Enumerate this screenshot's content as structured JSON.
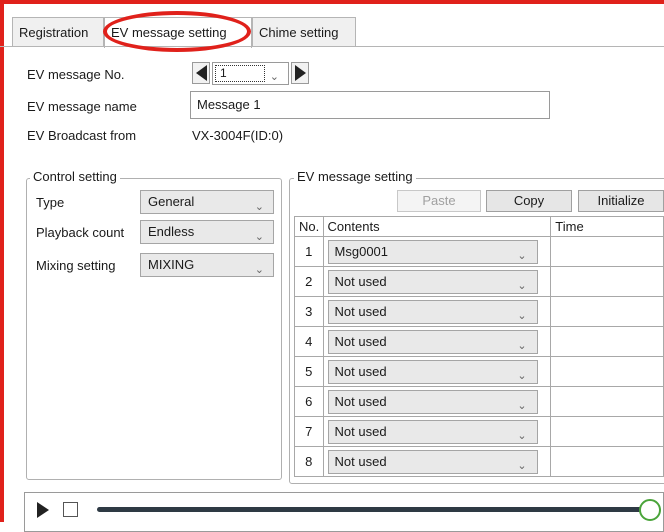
{
  "tabs": [
    {
      "label": "Registration"
    },
    {
      "label": "EV message setting"
    },
    {
      "label": "Chime setting"
    }
  ],
  "active_tab": "EV message setting",
  "header": {
    "no_label": "EV message No.",
    "no_value": "1",
    "name_label": "EV message name",
    "name_value": "Message 1",
    "from_label": "EV Broadcast from",
    "from_value": "VX-3004F(ID:0)"
  },
  "control": {
    "title": "Control setting",
    "type_label": "Type",
    "type_value": "General",
    "playback_label": "Playback count",
    "playback_value": "Endless",
    "mixing_label": "Mixing setting",
    "mixing_value": "MIXING"
  },
  "ev_setting": {
    "title": "EV message setting",
    "paste_label": "Paste",
    "copy_label": "Copy",
    "initialize_label": "Initialize",
    "columns": [
      "No.",
      "Contents",
      "Time"
    ],
    "rows": [
      {
        "no": "1",
        "contents": "Msg0001"
      },
      {
        "no": "2",
        "contents": "Not used"
      },
      {
        "no": "3",
        "contents": "Not used"
      },
      {
        "no": "4",
        "contents": "Not used"
      },
      {
        "no": "5",
        "contents": "Not used"
      },
      {
        "no": "6",
        "contents": "Not used"
      },
      {
        "no": "7",
        "contents": "Not used"
      },
      {
        "no": "8",
        "contents": "Not used"
      }
    ]
  },
  "colors": {
    "highlight": "#e0211b",
    "seek_thumb": "#4aa43a"
  }
}
